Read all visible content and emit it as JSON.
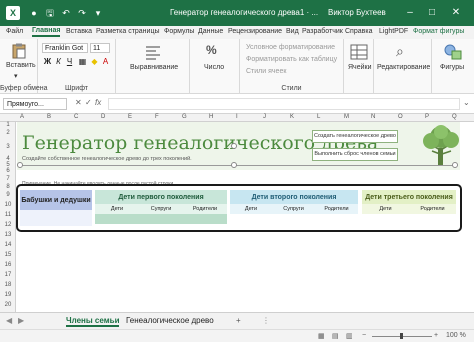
{
  "window": {
    "title": "Генератор генеалогического древа1 · ...",
    "user": "Виктор Бухтеев",
    "app_icon": "excel-icon"
  },
  "tabs": [
    "Файл",
    "Главная",
    "Вставка",
    "Разметка страницы",
    "Формулы",
    "Данные",
    "Рецензирование",
    "Вид",
    "Разработчик",
    "Справка",
    "LightPDF",
    "Формат фигуры"
  ],
  "ribbon": {
    "paste": "Вставить",
    "clipboard": "Буфер обмена",
    "font_name": "Franklin Got",
    "font_size": "11",
    "font_group": "Шрифт",
    "alignment": "Выравнивание",
    "number": "Число",
    "cond_format": "Условное форматирование",
    "format_table": "Форматировать как таблицу",
    "cell_styles": "Стили ячеек",
    "styles": "Стили",
    "cells": "Ячейки",
    "editing": "Редактирование",
    "shapes": "Фигуры"
  },
  "formula_bar": {
    "name_box": "Прямоуго...",
    "fx": "fx",
    "cancel": "✕",
    "enter": "✓"
  },
  "columns": [
    "A",
    "B",
    "C",
    "D",
    "E",
    "F",
    "G",
    "H",
    "I",
    "J",
    "K",
    "L",
    "M",
    "N",
    "O",
    "P",
    "Q"
  ],
  "rows": [
    "1",
    "2",
    "3",
    "4",
    "5",
    "6",
    "7",
    "8",
    "9",
    "10",
    "11",
    "12",
    "13",
    "14",
    "15",
    "16",
    "17",
    "18",
    "19",
    "20"
  ],
  "sheet": {
    "title": "Генератор генеалогического древа",
    "subtitle": "Создайте собственное генеалогическое древо до трех поколений.",
    "btn_create": "Создать генеалогическое древо",
    "btn_reset": "Выполнить сброс членов семьи",
    "note": "Примечание. Не начинайте вводить данные после пустой строки.",
    "groups": [
      {
        "name": "Бабушки и дедушки",
        "cols": [],
        "color": "#b6c4e8"
      },
      {
        "name": "Дети первого поколения",
        "cols": [
          "Дети",
          "Супруги",
          "Родители"
        ],
        "color": "#c8e6d9"
      },
      {
        "name": "Дети второго поколения",
        "cols": [
          "Дети",
          "Супруги",
          "Родители"
        ],
        "color": "#c7e6f1"
      },
      {
        "name": "Дети третьего поколения",
        "cols": [
          "Дети",
          "Родители"
        ],
        "color": "#e3f0c6"
      }
    ]
  },
  "sheet_tabs": [
    "Члены семьи",
    "Генеалогическое древо"
  ],
  "status": {
    "zoom": "100 %"
  }
}
